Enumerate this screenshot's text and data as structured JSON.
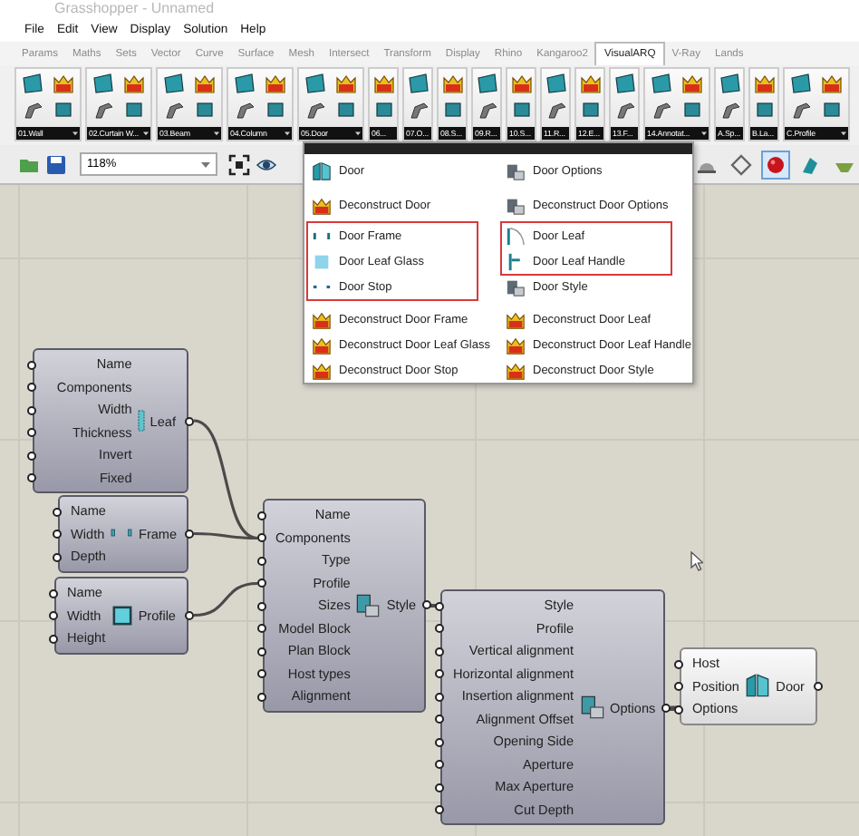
{
  "window": {
    "title": "Grasshopper - Unnamed"
  },
  "menu": [
    "File",
    "Edit",
    "View",
    "Display",
    "Solution",
    "Help"
  ],
  "tabs": [
    {
      "label": "Params",
      "selected": false
    },
    {
      "label": "Maths",
      "selected": false
    },
    {
      "label": "Sets",
      "selected": false
    },
    {
      "label": "Vector",
      "selected": false
    },
    {
      "label": "Curve",
      "selected": false
    },
    {
      "label": "Surface",
      "selected": false
    },
    {
      "label": "Mesh",
      "selected": false
    },
    {
      "label": "Intersect",
      "selected": false
    },
    {
      "label": "Transform",
      "selected": false
    },
    {
      "label": "Display",
      "selected": false
    },
    {
      "label": "Rhino",
      "selected": false
    },
    {
      "label": "Kangaroo2",
      "selected": false
    },
    {
      "label": "VisualARQ",
      "selected": true
    },
    {
      "label": "V-Ray",
      "selected": false
    },
    {
      "label": "Lands",
      "selected": false
    }
  ],
  "ribbon": [
    {
      "label": "01.Wall",
      "kind": "wide"
    },
    {
      "label": "02.Curtain W...",
      "kind": "wide"
    },
    {
      "label": "03.Beam",
      "kind": "wide"
    },
    {
      "label": "04.Column",
      "kind": "wide"
    },
    {
      "label": "05.Door",
      "kind": "wide"
    },
    {
      "label": "06...",
      "kind": "narrow"
    },
    {
      "label": "07.O...",
      "kind": "narrow"
    },
    {
      "label": "08.S...",
      "kind": "narrow"
    },
    {
      "label": "09.R...",
      "kind": "narrow"
    },
    {
      "label": "10.S...",
      "kind": "narrow"
    },
    {
      "label": "11.R...",
      "kind": "narrow"
    },
    {
      "label": "12.E...",
      "kind": "narrow"
    },
    {
      "label": "13.F...",
      "kind": "narrow"
    },
    {
      "label": "14.Annotat...",
      "kind": "wide"
    },
    {
      "label": "A.Sp...",
      "kind": "narrow"
    },
    {
      "label": "B.La...",
      "kind": "narrow"
    },
    {
      "label": "C.Profile",
      "kind": "wide"
    }
  ],
  "canvas_toolbar": {
    "zoom": "118%",
    "toggles": [
      {
        "kind": "dome",
        "selected": false
      },
      {
        "kind": "diamond",
        "selected": false
      },
      {
        "kind": "sphere",
        "selected": true
      },
      {
        "kind": "brush",
        "selected": false
      },
      {
        "kind": "bowl",
        "selected": false
      }
    ]
  },
  "dropdown": {
    "columns": [
      {
        "sections": [
          {
            "outlined": false,
            "items": [
              {
                "label": "Door",
                "kind": "door"
              },
              {
                "label": "Deconstruct Door",
                "kind": "crown"
              }
            ]
          },
          {
            "outlined": true,
            "items": [
              {
                "label": "Door Frame",
                "kind": "frame"
              },
              {
                "label": "Door Leaf Glass",
                "kind": "glass"
              },
              {
                "label": "Door Stop",
                "kind": "stop"
              }
            ]
          },
          {
            "outlined": false,
            "items": [
              {
                "label": "Deconstruct Door Frame",
                "kind": "crown"
              },
              {
                "label": "Deconstruct Door Leaf Glass",
                "kind": "crown"
              },
              {
                "label": "Deconstruct Door Stop",
                "kind": "crown"
              }
            ]
          }
        ]
      },
      {
        "sections": [
          {
            "outlined": false,
            "items": [
              {
                "label": "Door Options",
                "kind": "options"
              },
              {
                "label": "Deconstruct Door Options",
                "kind": "options"
              }
            ]
          },
          {
            "outlined": true,
            "items": [
              {
                "label": "Door Leaf",
                "kind": "leaf"
              },
              {
                "label": "Door Leaf Handle",
                "kind": "handle"
              }
            ]
          },
          {
            "outlined": false,
            "items": [
              {
                "label": "Door Style",
                "kind": "options"
              }
            ]
          },
          {
            "outlined": false,
            "items": [
              {
                "label": "Deconstruct Door Leaf",
                "kind": "crown"
              },
              {
                "label": "Deconstruct Door Leaf Handle",
                "kind": "crown"
              },
              {
                "label": "Deconstruct Door Style",
                "kind": "crown"
              }
            ]
          }
        ]
      }
    ]
  },
  "nodes": [
    {
      "kind": "component",
      "inputs": [
        "Name",
        "Components",
        "Width",
        "Thickness",
        "Invert",
        "Fixed"
      ],
      "output": "Leaf"
    },
    {
      "kind": "compact",
      "inputs": [
        "Name",
        "Width",
        "Depth"
      ],
      "output": "Frame"
    },
    {
      "kind": "compact",
      "inputs": [
        "Name",
        "Width",
        "Height"
      ],
      "output": "Profile"
    },
    {
      "kind": "component",
      "inputs": [
        "Name",
        "Components",
        "Type",
        "Profile",
        "Sizes",
        "Model Block",
        "Plan Block",
        "Host types",
        "Alignment"
      ],
      "output": "Style"
    },
    {
      "kind": "component",
      "inputs": [
        "Style",
        "Profile",
        "Vertical alignment",
        "Horizontal alignment",
        "Insertion alignment",
        "Alignment Offset",
        "Opening Side",
        "Aperture",
        "Max Aperture",
        "Cut Depth"
      ],
      "output": "Options"
    },
    {
      "kind": "light",
      "inputs": [
        "Host",
        "Position",
        "Options"
      ],
      "output": "Door"
    }
  ]
}
